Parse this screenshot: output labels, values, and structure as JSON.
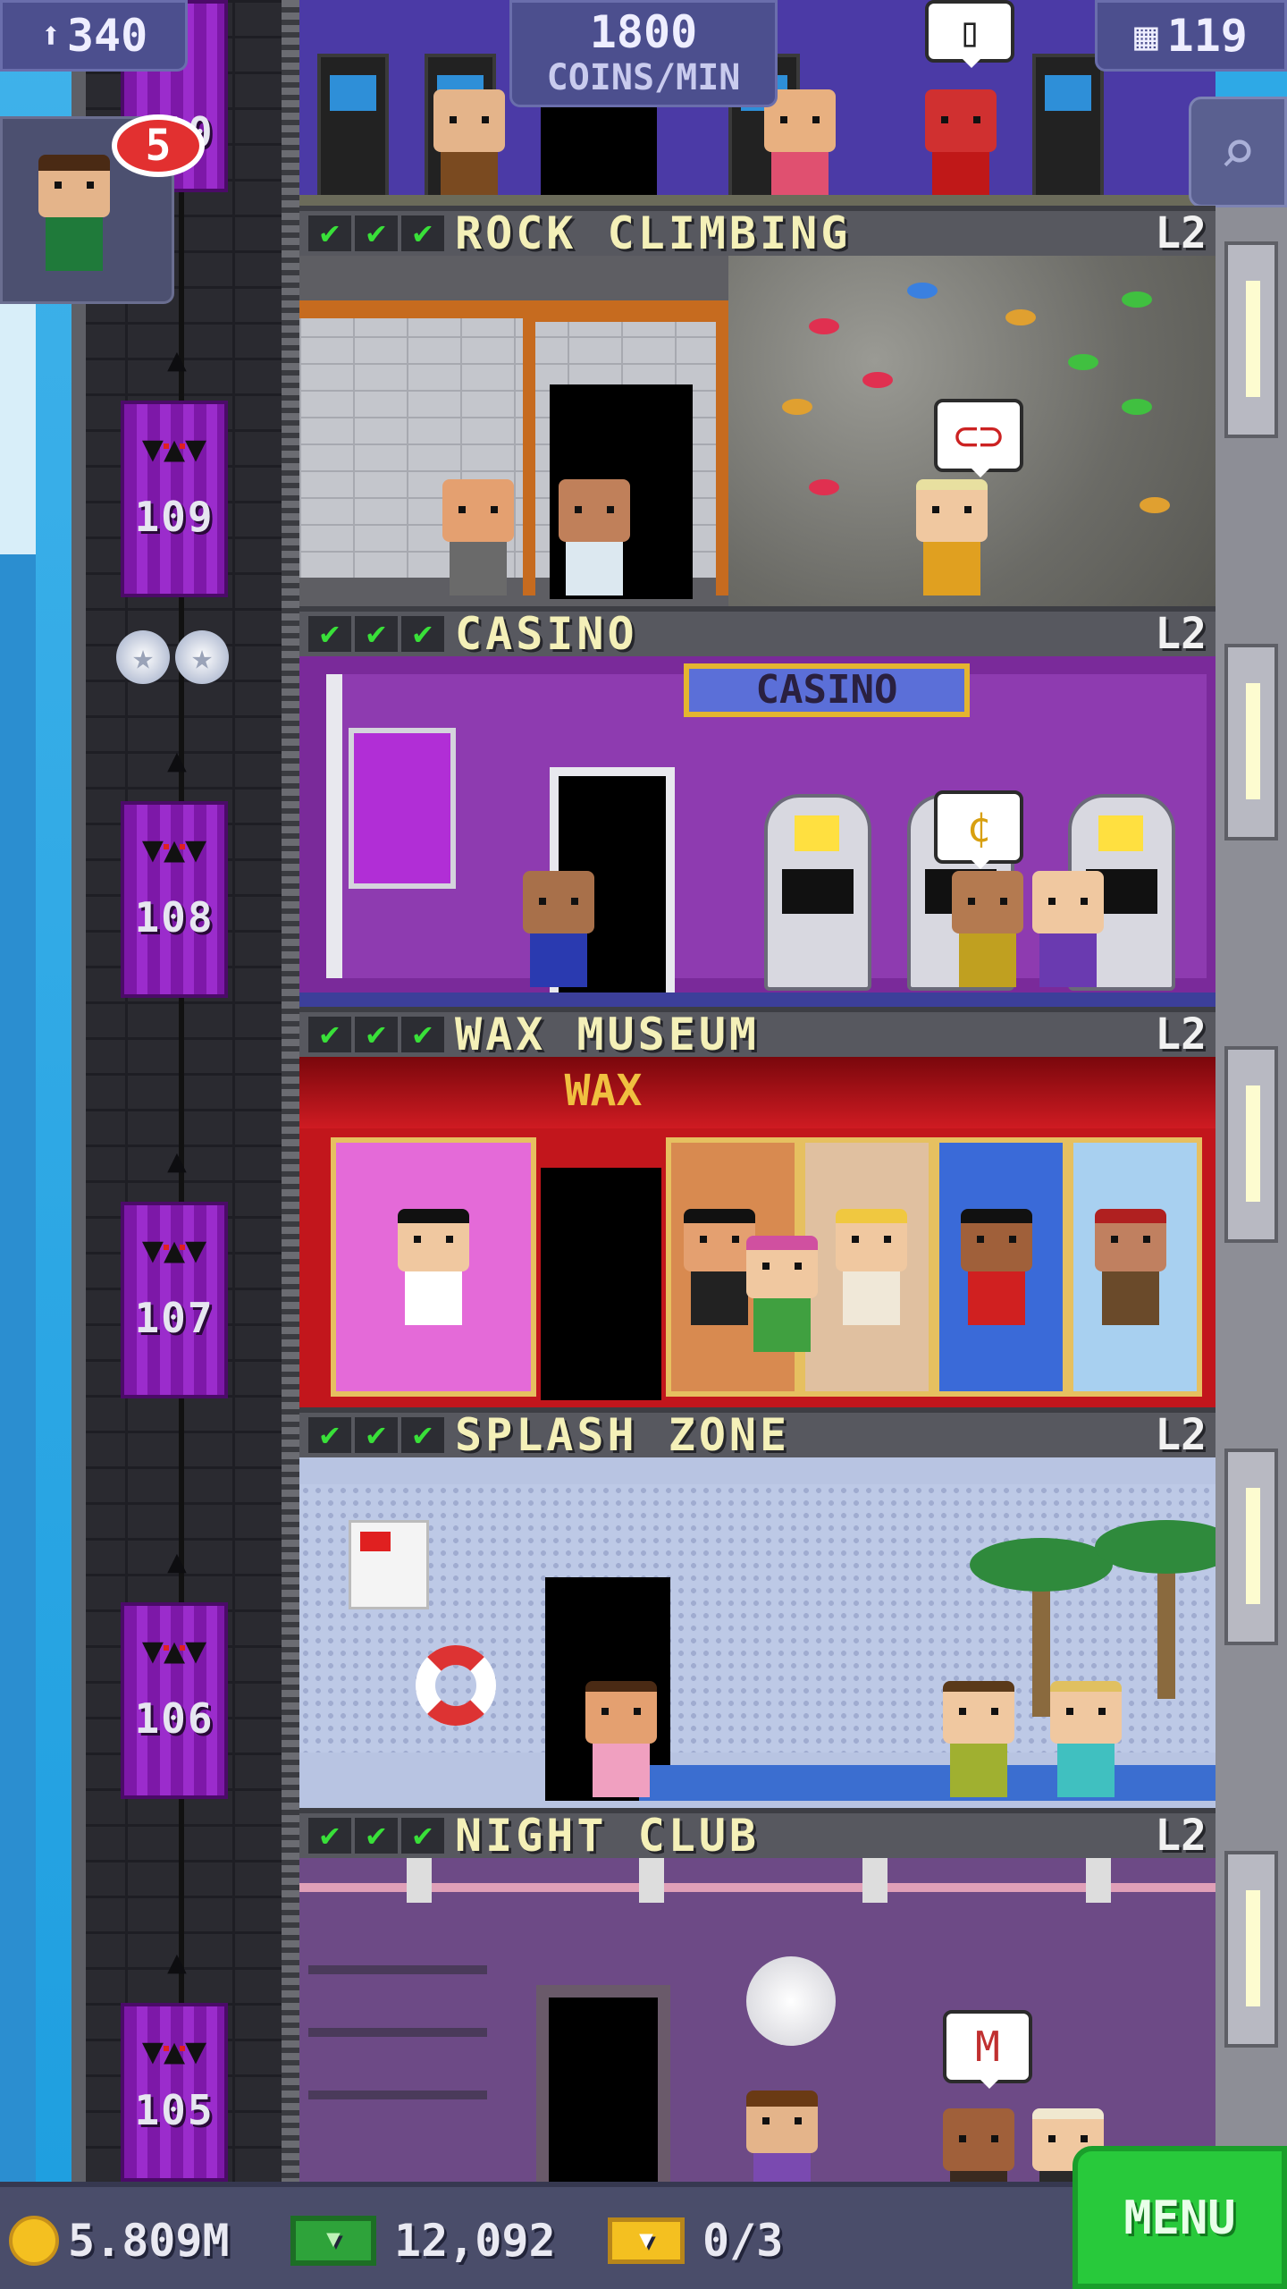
{
  "hud": {
    "population": "340",
    "coins_per_min_value": "1800",
    "coins_per_min_label": "COINS/MIN",
    "floors": "119",
    "vip_badge": "5",
    "search_icon": "magnifier-icon"
  },
  "shaft": {
    "top_floor": "110",
    "star_count": 2,
    "elevators": [
      {
        "floor": "109"
      },
      {
        "floor": "108"
      },
      {
        "floor": "107"
      },
      {
        "floor": "106"
      },
      {
        "floor": "105"
      }
    ]
  },
  "floors": [
    {
      "name": "ROCK CLIMBING",
      "level": "L2",
      "checks": "✔",
      "bubble": "⊂⊃"
    },
    {
      "name": "CASINO",
      "level": "L2",
      "checks": "✔",
      "sign": "CASINO",
      "bubble": "¢"
    },
    {
      "name": "WAX MUSEUM",
      "level": "L2",
      "checks": "✔",
      "sign": "WAX"
    },
    {
      "name": "SPLASH ZONE",
      "level": "L2",
      "checks": "✔"
    },
    {
      "name": "NIGHT CLUB",
      "level": "L2",
      "checks": "✔",
      "bubble": "M"
    }
  ],
  "bottom": {
    "coins": "5.809M",
    "bux": "12,092",
    "tickets": "0/3",
    "menu_label": "MENU"
  },
  "colors": {
    "accent_green": "#28c93b",
    "check_green": "#39e039",
    "elevator_purple": "#9b2ccc",
    "floor_header": "#57585f"
  }
}
